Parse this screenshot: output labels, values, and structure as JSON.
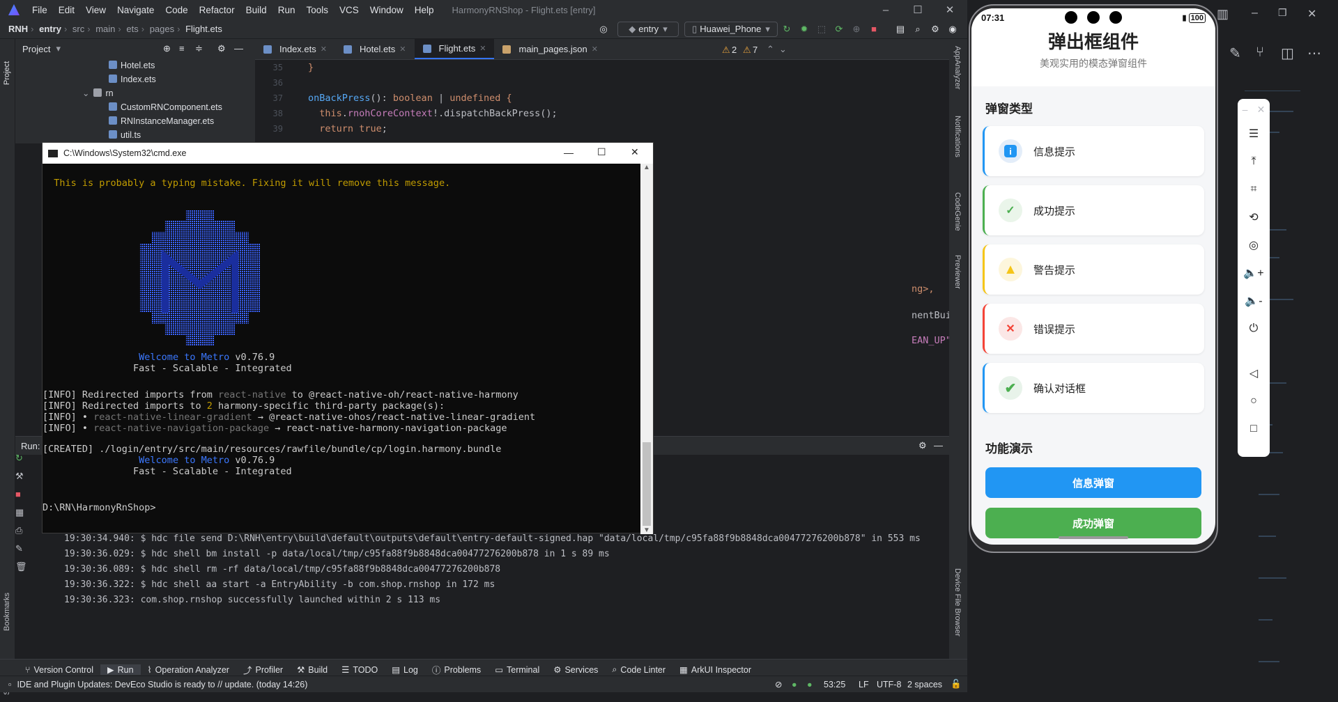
{
  "ide": {
    "menu": [
      "File",
      "Edit",
      "View",
      "Navigate",
      "Code",
      "Refactor",
      "Build",
      "Run",
      "Tools",
      "VCS",
      "Window",
      "Help"
    ],
    "window_title": "HarmonyRNShop - Flight.ets [entry]",
    "breadcrumb": [
      "RNH",
      "entry",
      "src",
      "main",
      "ets",
      "pages",
      "Flight.ets"
    ],
    "run_config": "entry",
    "device": "Huawei_Phone",
    "project_label": "Project",
    "tree": [
      "Hotel.ets",
      "Index.ets",
      "rn",
      "CustomRNComponent.ets",
      "RNInstanceManager.ets",
      "util.ts"
    ],
    "tabs": [
      "Index.ets",
      "Hotel.ets",
      "Flight.ets",
      "main_pages.json"
    ],
    "active_tab": "Flight.ets",
    "warnings": "2",
    "weak_warnings": "7",
    "gutter": [
      "35",
      "36",
      "37",
      "38",
      "39"
    ],
    "code": {
      "l35": "}",
      "l37_fn": "onBackPress",
      "l37_rest": "(): ",
      "l37_t1": "boolean",
      "l37_bar": " | ",
      "l37_t2": "undefined",
      "l37_brace": " {",
      "l38_this": "this",
      "l38_dot": ".",
      "l38_prop": "rnohCoreContext",
      "l38_call": "!.dispatchBackPress();",
      "l39_ret": "return",
      "l39_val": "true",
      "l39_semi": ";",
      "frag1": "ng>,",
      "frag2": "nentBuilder,",
      "frag3": "EAN_UP\");"
    },
    "run_tab": "Run:",
    "run_log": [
      "19:30:34.940: $ hdc file send D:\\RNH\\entry\\build\\default\\outputs\\default\\entry-default-signed.hap \"data/local/tmp/c95fa88f9b8848dca00477276200b878\" in 553 ms",
      "19:30:36.029: $ hdc shell bm install -p data/local/tmp/c95fa88f9b8848dca00477276200b878  in 1 s 89 ms",
      "19:30:36.089: $ hdc shell rm -rf data/local/tmp/c95fa88f9b8848dca00477276200b878",
      "19:30:36.322: $ hdc shell aa start -a EntryAbility -b com.shop.rnshop in 172 ms",
      "19:30:36.323: com.shop.rnshop successfully launched within 2 s 113 ms"
    ],
    "bottom_tabs": [
      "Version Control",
      "Run",
      "Operation Analyzer",
      "Profiler",
      "Build",
      "TODO",
      "Log",
      "Problems",
      "Terminal",
      "Services",
      "Code Linter",
      "ArkUI Inspector"
    ],
    "active_bottom": "Run",
    "status_message": "IDE and Plugin Updates: DevEco Studio is ready to // update. (today 14:26)",
    "status_right": [
      "53:25",
      "LF",
      "UTF-8",
      "2 spaces"
    ],
    "left_tools": [
      "Project",
      "Bookmarks",
      "Structure"
    ],
    "right_tools": [
      "AppAnalyzer",
      "Notifications",
      "CodeGenie",
      "Previewer",
      "Device File Browser"
    ]
  },
  "cmd": {
    "title": "C:\\Windows\\System32\\cmd.exe",
    "warning_line": "  This is probably a typing mistake. Fixing it will remove this message.",
    "welcome_pre": "                 ",
    "welcome_word": "Welcome to Metro",
    "version": " v0.76.9",
    "tagline": "                Fast - Scalable - Integrated",
    "info1_a": "[INFO] Redirected imports from ",
    "info1_b": "react-native",
    "info1_c": " to @react-native-oh/react-native-harmony",
    "info2_a": "[INFO] Redirected imports to ",
    "info2_b": "2",
    "info2_c": " harmony-specific third-party package(s):",
    "info3_a": "[INFO] • ",
    "info3_b": "react-native-linear-gradient",
    "info3_c": " → @react-native-ohos/react-native-linear-gradient",
    "info4_a": "[INFO] • ",
    "info4_b": "react-native-navigation-package",
    "info4_c": " → react-native-harmony-navigation-package",
    "created": "[CREATED] ./login/entry/src/main/resources/rawfile/bundle/cp/login.harmony.bundle",
    "prompt": "D:\\RN\\HarmonyRnShop>"
  },
  "phone": {
    "time": "07:31",
    "battery": "100",
    "title": "弹出框组件",
    "subtitle": "美观实用的模态弹窗组件",
    "section1": "弹窗类型",
    "cards": [
      {
        "label": "信息提示",
        "icon": "i",
        "color": "#2196f3",
        "bg": "#e3edf9"
      },
      {
        "label": "成功提示",
        "icon": "✓",
        "color": "#4caf50",
        "bg": "#eaf5ea"
      },
      {
        "label": "警告提示",
        "icon": "!",
        "color": "#f5c518",
        "bg": "#fdf6dc"
      },
      {
        "label": "错误提示",
        "icon": "✕",
        "color": "#f44336",
        "bg": "#fbe7e6"
      },
      {
        "label": "确认对话框",
        "icon": "✔",
        "color": "#2196f3",
        "bg": "#e8f3ea"
      }
    ],
    "section2": "功能演示",
    "buttons": [
      {
        "label": "信息弹窗",
        "color": "#2196f3"
      },
      {
        "label": "成功弹窗",
        "color": "#4caf50"
      }
    ],
    "peek_color": "#f44336"
  }
}
